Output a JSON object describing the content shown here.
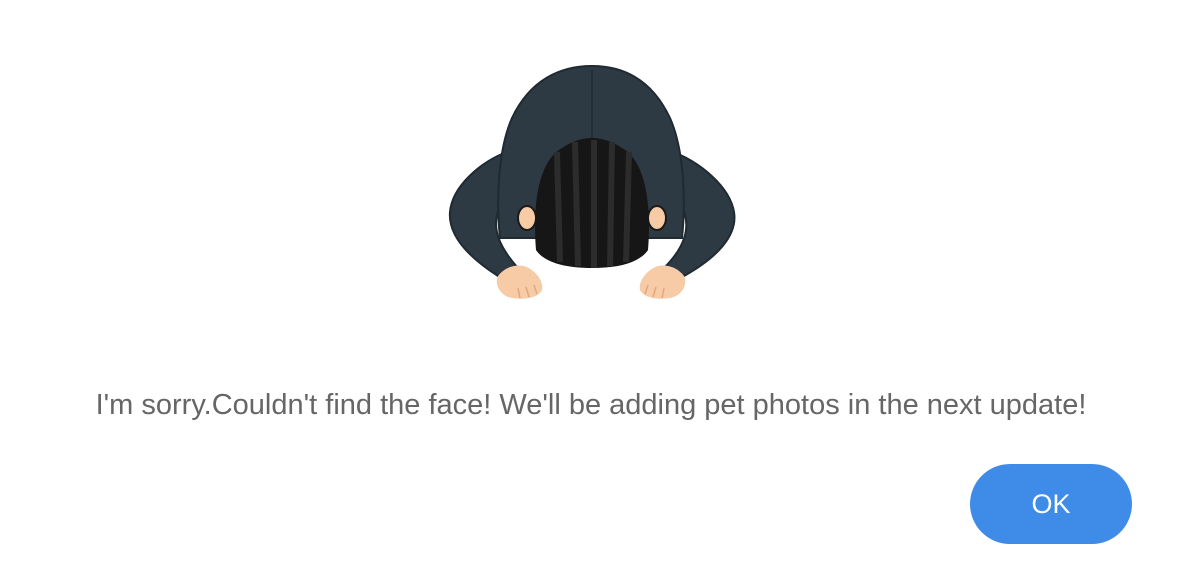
{
  "dialog": {
    "illustration": {
      "icon": "bowing-person-icon",
      "colors": {
        "jacket": "#2d3a44",
        "jacket_dark": "#222d35",
        "hair": "#161616",
        "hair_stripe": "#2c2c2c",
        "skin": "#f6cba6",
        "skin_line": "#e0a880"
      }
    },
    "message": "I'm sorry.Couldn't find the face! We'll be adding pet photos in the next update!",
    "ok_label": "OK",
    "colors": {
      "text": "#666666",
      "button": "#3f8be8",
      "button_text": "#ffffff",
      "background": "#ffffff"
    }
  }
}
